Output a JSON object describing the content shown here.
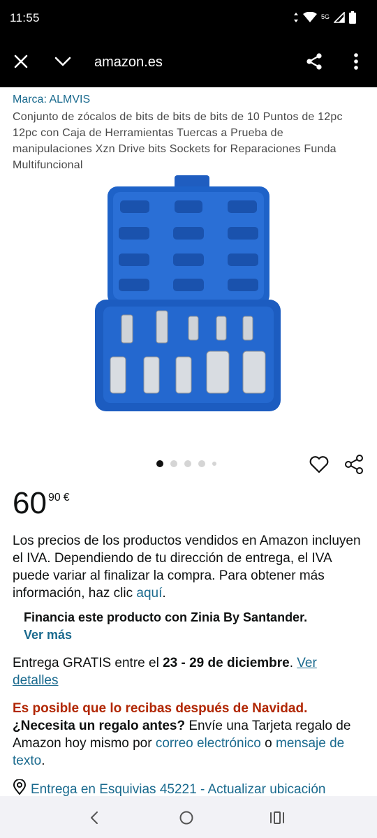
{
  "status_bar": {
    "time": "11:55",
    "network": "5G"
  },
  "toolbar": {
    "url": "amazon.es"
  },
  "product": {
    "brand": "Marca: ALMVIS",
    "title": "Conjunto de zócalos de bits de bits de bits de 10 Puntos de 12pc 12pc con Caja de Herramientas Tuercas a Prueba de manipulaciones Xzn Drive bits Sockets for Reparaciones Funda Multifuncional",
    "image_count": 5,
    "active_image": 1
  },
  "price": {
    "whole": "60",
    "fraction": "90",
    "currency": "€"
  },
  "vat": {
    "text": "Los precios de los productos vendidos en Amazon incluyen el IVA. Dependiendo de tu dirección de entrega, el IVA puede variar al finalizar la compra. Para obtener más información, haz clic ",
    "link": "aquí",
    "end": "."
  },
  "finance": {
    "text": "Financia este producto con Zinia By Santander.",
    "link": "Ver más"
  },
  "delivery": {
    "prefix": "Entrega GRATIS entre el ",
    "dates": "23 - 29 de diciembre",
    "mid": ". ",
    "link": "Ver detalles"
  },
  "christmas": {
    "warning": "Es posible que lo recibas después de Navidad.",
    "question": "¿Necesita un regalo antes?",
    "text1": " Envíe una Tarjeta regalo de Amazon hoy mismo por ",
    "link1": "correo electrónico",
    "text2": " o ",
    "link2": "mensaje de texto",
    "end": "."
  },
  "location": {
    "text": "Entrega en Esquivias 45221 - Actualizar ubicación"
  },
  "colors": {
    "link": "#1a6a8e",
    "warning": "#b12704",
    "toolbar": "#000000"
  }
}
